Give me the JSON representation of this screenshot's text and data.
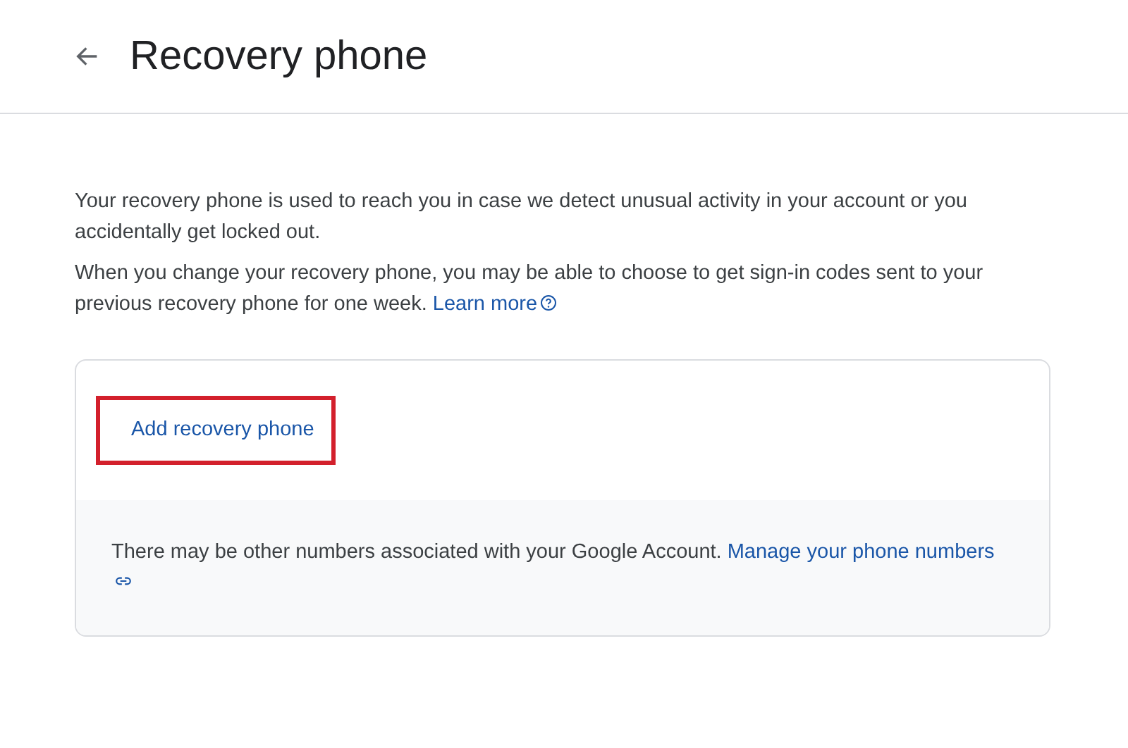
{
  "header": {
    "title": "Recovery phone"
  },
  "intro": [
    {
      "text": "Your recovery phone is used to reach you in case we detect unusual activity in your account or you accidentally get locked out."
    },
    {
      "text": "When you change your recovery phone, you may be able to choose to get sign-in codes sent to your previous recovery phone for one week.",
      "link": "Learn more"
    }
  ],
  "card": {
    "action": {
      "label": "Add recovery phone",
      "highlighted": true
    },
    "note": {
      "text": "There may be other numbers associated with your Google Account.",
      "link": "Manage your phone numbers"
    }
  }
}
